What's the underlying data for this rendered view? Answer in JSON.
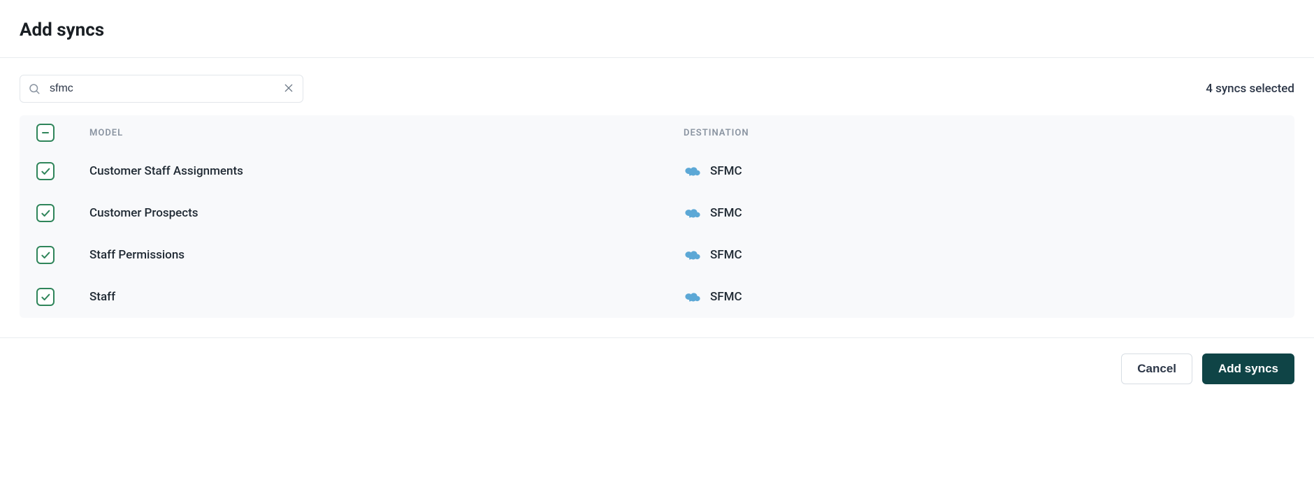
{
  "header": {
    "title": "Add syncs"
  },
  "search": {
    "value": "sfmc",
    "placeholder": "Search"
  },
  "selected_count": 4,
  "selected_text": "4 syncs selected",
  "columns": {
    "model": "MODEL",
    "destination": "DESTINATION"
  },
  "destination_icon": "salesforce-cloud-icon",
  "colors": {
    "accent": "#0f4446",
    "checkbox": "#2f855a",
    "cloud": "#5ca8d6"
  },
  "rows": [
    {
      "checked": true,
      "model": "Customer Staff Assignments",
      "destination": "SFMC"
    },
    {
      "checked": true,
      "model": "Customer Prospects",
      "destination": "SFMC"
    },
    {
      "checked": true,
      "model": "Staff Permissions",
      "destination": "SFMC"
    },
    {
      "checked": true,
      "model": "Staff",
      "destination": "SFMC"
    }
  ],
  "toolbar_checkbox_state": "indeterminate",
  "footer": {
    "cancel_label": "Cancel",
    "submit_label": "Add syncs"
  }
}
